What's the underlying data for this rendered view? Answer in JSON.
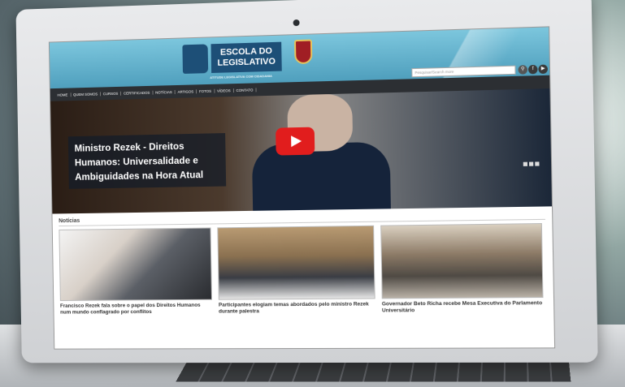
{
  "site": {
    "logo_line1": "ESCOLA DO",
    "logo_line2": "LEGISLATIVO",
    "tagline": "ATITUDE LEGISLATIVA COM CIDADANIA",
    "search_placeholder": "Pesquisar/Search more"
  },
  "nav": [
    "Home",
    "Quem Somos",
    "Cursos",
    "Certificados",
    "Notícias",
    "Artigos",
    "Fotos",
    "Vídeos",
    "Contato"
  ],
  "hero": {
    "caption": "Ministro Rezek - Direitos Humanos: Universalidade e Ambiguidades na Hora Atual"
  },
  "news": {
    "heading": "Notícias",
    "items": [
      {
        "title": "Francisco Rezek fala sobre o papel dos Direitos Humanos num mundo conflagrado por conflitos"
      },
      {
        "title": "Participantes elogiam temas abordados pelo ministro Rezek durante palestra"
      },
      {
        "title": "Governador Beto Richa recebe Mesa Executiva do Parlamento Universitário"
      }
    ]
  }
}
